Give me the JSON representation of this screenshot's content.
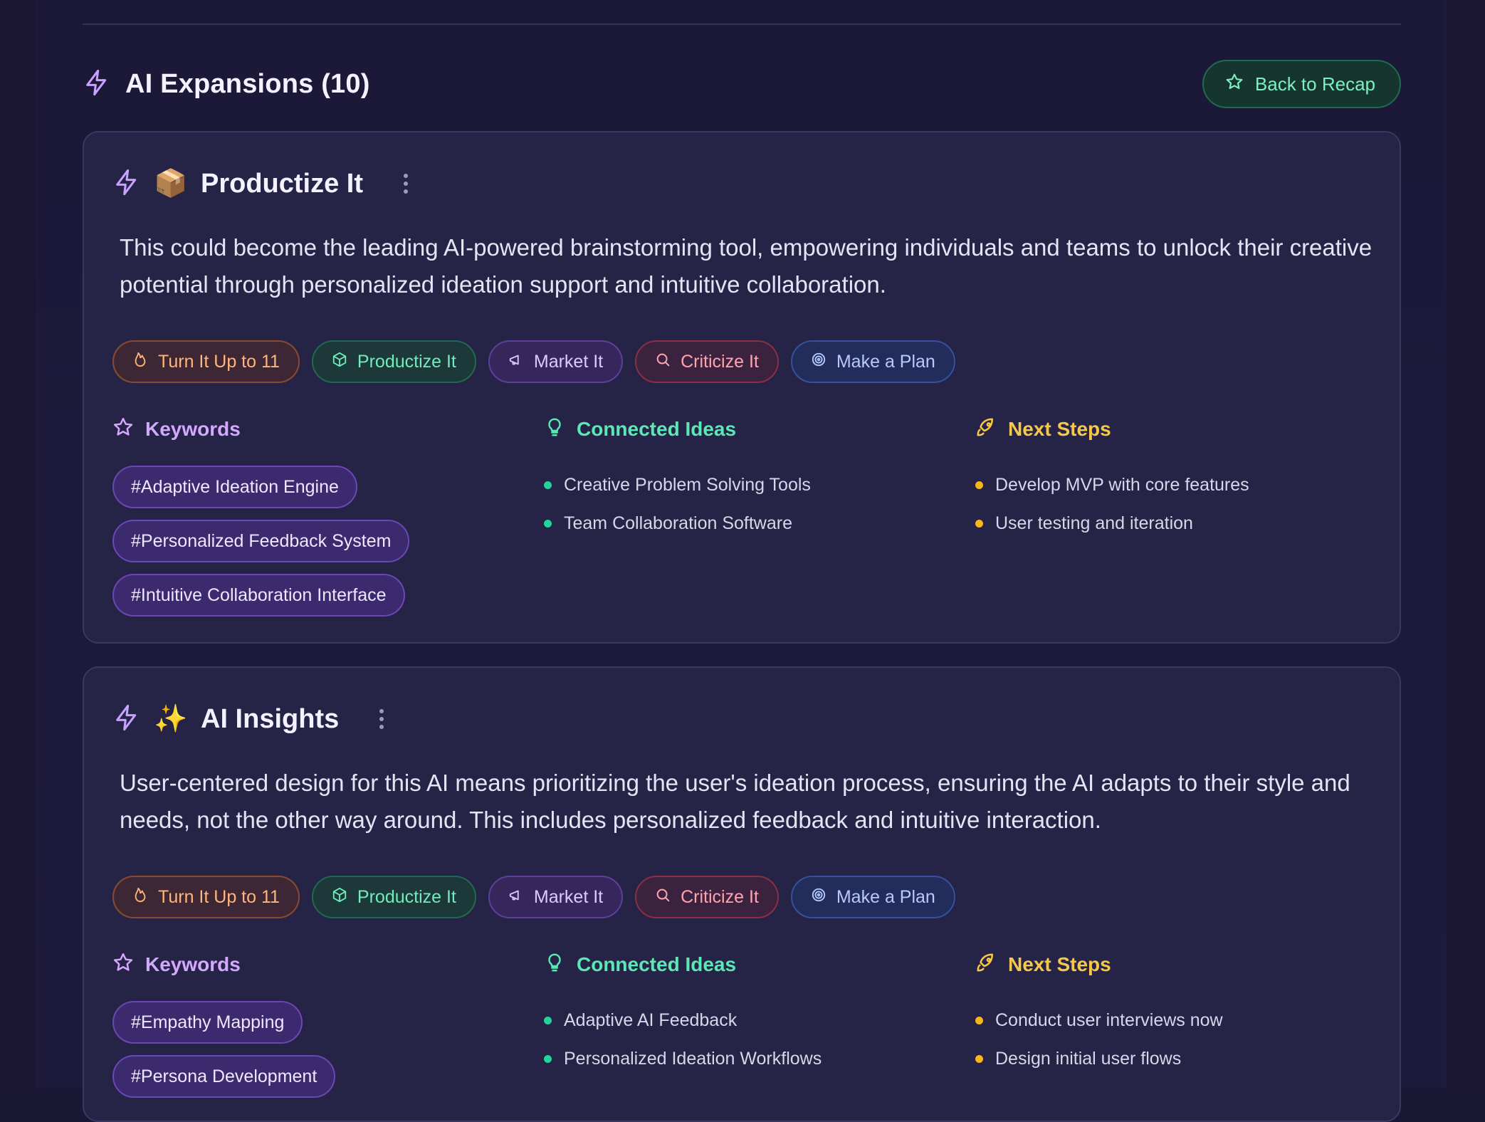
{
  "section": {
    "title": "AI Expansions (10)",
    "back_button": "Back to Recap"
  },
  "colors": {
    "accent_purple": "#c9a1ff",
    "accent_green": "#5ce8b4",
    "accent_amber": "#f5c84a"
  },
  "cards": [
    {
      "emoji": "📦",
      "title": "Productize It",
      "text": "This could become the leading AI-powered brainstorming tool, empowering individuals and teams to unlock their creative potential through personalized ideation support and intuitive collaboration.",
      "actions": [
        "Turn It Up to 11",
        "Productize It",
        "Market It",
        "Criticize It",
        "Make a Plan"
      ],
      "keywords_label": "Keywords",
      "keywords": [
        "#Adaptive Ideation Engine",
        "#Personalized Feedback System",
        "#Intuitive Collaboration Interface"
      ],
      "connected_label": "Connected Ideas",
      "connected": [
        "Creative Problem Solving Tools",
        "Team Collaboration Software"
      ],
      "next_label": "Next Steps",
      "next": [
        "Develop MVP with core features",
        "User testing and iteration"
      ]
    },
    {
      "emoji": "✨",
      "title": "AI Insights",
      "text": "User-centered design for this AI means prioritizing the user's ideation process, ensuring the AI adapts to their style and needs, not the other way around. This includes personalized feedback and intuitive interaction.",
      "actions": [
        "Turn It Up to 11",
        "Productize It",
        "Market It",
        "Criticize It",
        "Make a Plan"
      ],
      "keywords_label": "Keywords",
      "keywords": [
        "#Empathy Mapping",
        "#Persona Development"
      ],
      "connected_label": "Connected Ideas",
      "connected": [
        "Adaptive AI Feedback",
        "Personalized Ideation Workflows"
      ],
      "next_label": "Next Steps",
      "next": [
        "Conduct user interviews now",
        "Design initial user flows"
      ]
    }
  ]
}
